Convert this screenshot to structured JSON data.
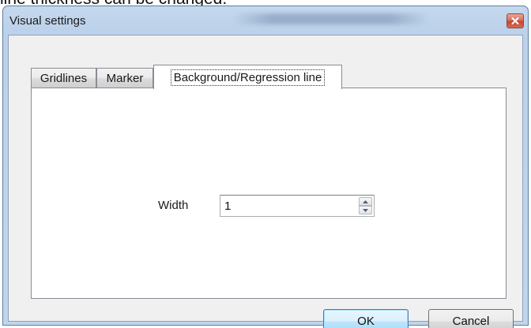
{
  "caption": {
    "text": "line thickness can be changed."
  },
  "window": {
    "title": "Visual settings",
    "close_icon": "close-icon"
  },
  "tabs": [
    {
      "label": "Gridlines",
      "active": false
    },
    {
      "label": "Marker",
      "active": false
    },
    {
      "label": "Background/Regression line",
      "active": true
    }
  ],
  "panel": {
    "width_label": "Width",
    "width_value": "1"
  },
  "buttons": {
    "ok_label": "OK",
    "cancel_label": "Cancel"
  },
  "colors": {
    "close_button": "#c2432e",
    "default_button_border": "#3c7fb1",
    "window_frame": "#c1d5eb"
  }
}
